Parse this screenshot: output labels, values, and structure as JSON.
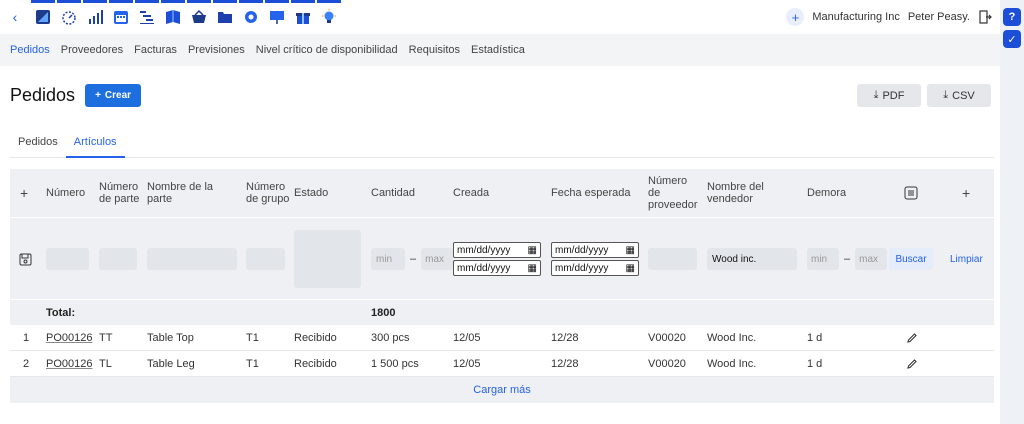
{
  "topbar": {
    "back_icon": "chevron-left-icon",
    "app_icons": [
      "pen-square-icon",
      "dashboard-gauge-icon",
      "bar-chart-icon",
      "calendar-icon",
      "gantt-icon",
      "book-icon",
      "basket-icon",
      "folder-icon",
      "gear-icon",
      "presentation-icon",
      "gift-icon",
      "lightbulb-icon"
    ],
    "company": "Manufacturing Inc",
    "user": "Peter Peasy."
  },
  "subnav": [
    "Pedidos",
    "Proveedores",
    "Facturas",
    "Previsiones",
    "Nivel crítico de disponibilidad",
    "Requisitos",
    "Estadística"
  ],
  "page": {
    "title": "Pedidos",
    "create_label": "Crear",
    "pdf_label": "PDF",
    "csv_label": "CSV"
  },
  "tabs": [
    "Pedidos",
    "Artículos"
  ],
  "columns": {
    "numero": "Número",
    "numero_parte": "Número de parte",
    "nombre_parte": "Nombre de la parte",
    "numero_grupo": "Número de grupo",
    "estado": "Estado",
    "cantidad": "Cantidad",
    "creada": "Creada",
    "fecha_esperada": "Fecha esperada",
    "numero_proveedor": "Número de proveedor",
    "nombre_vendedor": "Nombre del vendedor",
    "demora": "Demora"
  },
  "filters": {
    "min_placeholder": "min",
    "max_placeholder": "max",
    "date_placeholder": "mm/dd/yyyy",
    "vendor_value": "Wood inc.",
    "dash": "–",
    "search_label": "Buscar",
    "clear_label": "Limpiar"
  },
  "total": {
    "label": "Total:",
    "cantidad": "1800"
  },
  "rows": [
    {
      "idx": "1",
      "numero": "PO00126",
      "parte": "TT",
      "nombre": "Table Top",
      "grupo": "T1",
      "estado": "Recibido",
      "cantidad": "300 pcs",
      "creada": "12/05",
      "esperada": "12/28",
      "proveedor": "V00020",
      "vendedor": "Wood Inc.",
      "demora": "1 d"
    },
    {
      "idx": "2",
      "numero": "PO00126",
      "parte": "TL",
      "nombre": "Table Leg",
      "grupo": "T1",
      "estado": "Recibido",
      "cantidad": "1 500 pcs",
      "creada": "12/05",
      "esperada": "12/28",
      "proveedor": "V00020",
      "vendedor": "Wood Inc.",
      "demora": "1 d"
    }
  ],
  "load_more": "Cargar más",
  "colors": {
    "accent": "#1d6fe0",
    "header_bg": "#eef0f3"
  }
}
